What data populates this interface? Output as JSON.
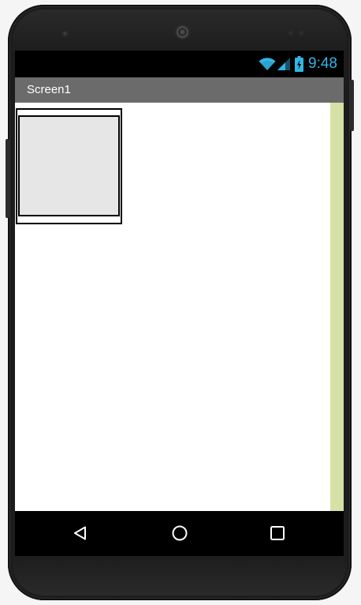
{
  "status_bar": {
    "time": "9:48",
    "icons": [
      "wifi-icon",
      "signal-icon",
      "battery-charging-icon"
    ],
    "accent_color": "#33b5e5"
  },
  "app_bar": {
    "title": "Screen1",
    "background_color": "#6b6b6b"
  },
  "canvas": {
    "background_color": "#ffffff",
    "scroll_strip_color": "#d6e1a6",
    "component": {
      "type": "empty-arrangement",
      "fill_color": "#e6e6e6"
    }
  },
  "navigation_bar": {
    "buttons": [
      "back-icon",
      "home-icon",
      "recents-icon"
    ]
  }
}
